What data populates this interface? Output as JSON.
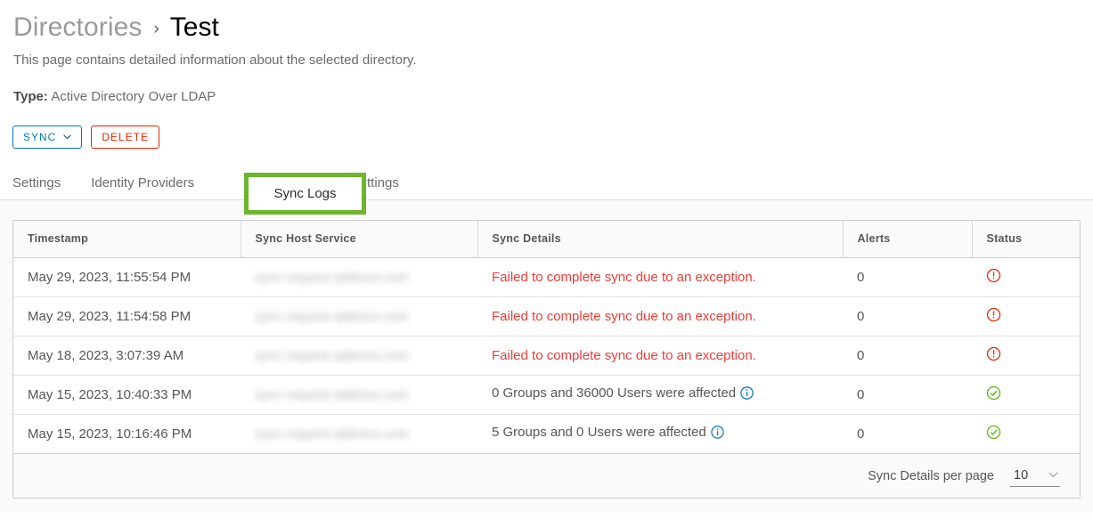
{
  "breadcrumb": {
    "root": "Directories",
    "separator": "›",
    "current": "Test"
  },
  "page": {
    "description": "This page contains detailed information about the selected directory.",
    "type_label": "Type:",
    "type_value": "Active Directory Over LDAP"
  },
  "actions": {
    "sync_label": "SYNC",
    "sync_caret": "⌄",
    "delete_label": "DELETE"
  },
  "tabs": [
    {
      "label": "Settings",
      "active": false
    },
    {
      "label": "Identity Providers",
      "active": false
    },
    {
      "label": "Sync Logs",
      "active": true
    },
    {
      "label": "Sync Settings",
      "active": false
    }
  ],
  "table": {
    "columns": [
      "Timestamp",
      "Sync Host Service",
      "Sync Details",
      "Alerts",
      "Status"
    ],
    "rows": [
      {
        "timestamp": "May 29, 2023, 11:55:54 PM",
        "host": "sync-request-address.com",
        "details": "Failed to complete sync due to an exception.",
        "details_state": "error",
        "has_info_icon": false,
        "alerts": "0",
        "status": "error"
      },
      {
        "timestamp": "May 29, 2023, 11:54:58 PM",
        "host": "sync-request-address.com",
        "details": "Failed to complete sync due to an exception.",
        "details_state": "error",
        "has_info_icon": false,
        "alerts": "0",
        "status": "error"
      },
      {
        "timestamp": "May 18, 2023, 3:07:39 AM",
        "host": "sync-request-address.com",
        "details": "Failed to complete sync due to an exception.",
        "details_state": "error",
        "has_info_icon": false,
        "alerts": "0",
        "status": "error"
      },
      {
        "timestamp": "May 15, 2023, 10:40:33 PM",
        "host": "sync-request-address.com",
        "details": "0 Groups and 36000 Users were affected",
        "details_state": "ok",
        "has_info_icon": true,
        "alerts": "0",
        "status": "success"
      },
      {
        "timestamp": "May 15, 2023, 10:16:46 PM",
        "host": "sync-request-address.com",
        "details": "5 Groups and 0 Users were affected",
        "details_state": "ok",
        "has_info_icon": true,
        "alerts": "0",
        "status": "success"
      }
    ]
  },
  "footer": {
    "per_page_label": "Sync Details per page",
    "per_page_value": "10",
    "per_page_caret": "⌄"
  },
  "colors": {
    "accent_blue": "#0079b8",
    "danger_red": "#e62700",
    "detail_red": "#ef3b36",
    "success_green": "#5eb715",
    "highlight_green": "#6cb52d",
    "text_gray": "#565656"
  }
}
